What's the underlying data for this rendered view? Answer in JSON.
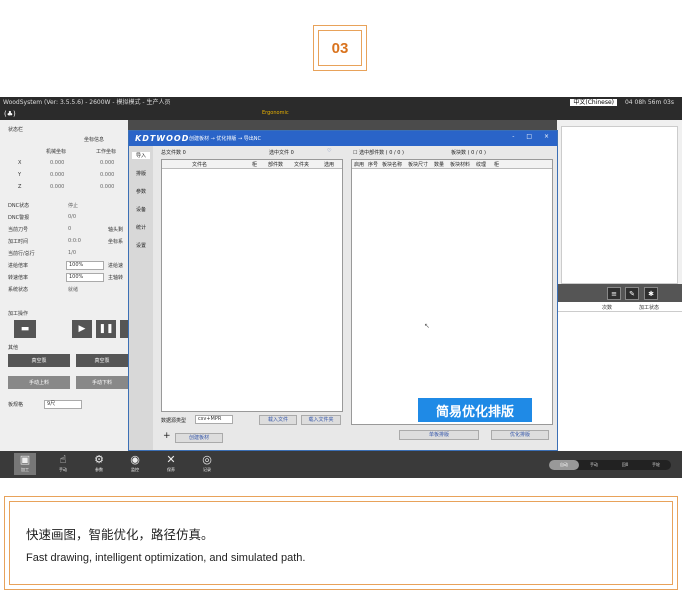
{
  "badge": {
    "number": "03"
  },
  "app": {
    "title": "WoodSystem (Ver: 3.5.5.6) - 2600W - 模拟模式 - 生产人员",
    "status": "04 08h 56m 03s",
    "layout_select": "中文(Chinese)",
    "note": "Ergonomic"
  },
  "left_panel": {
    "section_status": "状态栏",
    "coord_header": "坐标信息",
    "machine_coord": "机械坐标",
    "work_coord": "工作坐标",
    "axes": [
      {
        "axis": "X",
        "machine": "0.000",
        "work": "0.000"
      },
      {
        "axis": "Y",
        "machine": "0.000",
        "work": "0.000"
      },
      {
        "axis": "Z",
        "machine": "0.000",
        "work": "0.000"
      }
    ],
    "rows": [
      {
        "label": "DNC状态",
        "value": "停止"
      },
      {
        "label": "DNC警报",
        "value": "0/0"
      },
      {
        "label": "当前刀号",
        "value": "0"
      },
      {
        "label": "加工时间",
        "value": "0:0:0"
      },
      {
        "label": "当前行/总行",
        "value": "1/0"
      },
      {
        "label": "进给倍率",
        "value": "100%"
      },
      {
        "label": "转速倍率",
        "value": "100%"
      },
      {
        "label": "系统状态",
        "value": "就绪"
      }
    ],
    "extra_labels": {
      "spindle": "轴头剩",
      "coord_sys": "坐标系",
      "feed": "进给速",
      "main_axis": "主轴转"
    },
    "section_ops": "加工操作",
    "section_other": "其他",
    "btn_vacuum_on": "真空泵",
    "btn_vacuum_off": "真空泵",
    "btn_load": "手动上料",
    "btn_unload": "手动下料",
    "board_label": "板规格",
    "board_value": "9尺"
  },
  "dialog": {
    "logo": "KDTWOOD",
    "steps": "创建板材 → 优化排版 → 导出NC",
    "ctrl_min": "-",
    "ctrl_max": "□",
    "ctrl_close": "×",
    "side_items": [
      "导入",
      "排版",
      "参数",
      "设备",
      "统计",
      "设置"
    ],
    "left_pane": {
      "total_label": "总文件数",
      "total_value": "0",
      "selected_label": "选中文件",
      "selected_value": "0",
      "columns": [
        "文件名",
        "柜",
        "部件数",
        "文件夹",
        "选用"
      ],
      "data_type_label": "数据源类型",
      "data_type_value": "csv+MPR",
      "import_file": "载入文件",
      "import_folder": "载入文件夹",
      "create_board": "创建板材"
    },
    "right_pane": {
      "checkbox_label": "选中部件数 ( 0 / 0 )",
      "board_count": "板块数 ( 0 / 0 )",
      "columns": [
        "启用",
        "序号",
        "板块名称",
        "板块尺寸",
        "数量",
        "板块材料",
        "纹理",
        "柜"
      ],
      "btn_single": "单板排版",
      "btn_optimize": "优化排版"
    },
    "banner": "简易优化排版"
  },
  "right_panel": {
    "header_cols": [
      "次数",
      "加工状态"
    ]
  },
  "bottom_bar": {
    "items": [
      {
        "icon": "▣",
        "label": "加工"
      },
      {
        "icon": "☝",
        "label": "手动"
      },
      {
        "icon": "⚙",
        "label": "参数"
      },
      {
        "icon": "◉",
        "label": "监控"
      },
      {
        "icon": "✕",
        "label": "保养"
      },
      {
        "icon": "◎",
        "label": "记录"
      }
    ],
    "modes": [
      "自动",
      "手动",
      "回0",
      "手轮"
    ]
  },
  "caption": {
    "zh": "快速画图，智能优化，路径仿真。",
    "en": "Fast drawing, intelligent optimization, and simulated path."
  }
}
